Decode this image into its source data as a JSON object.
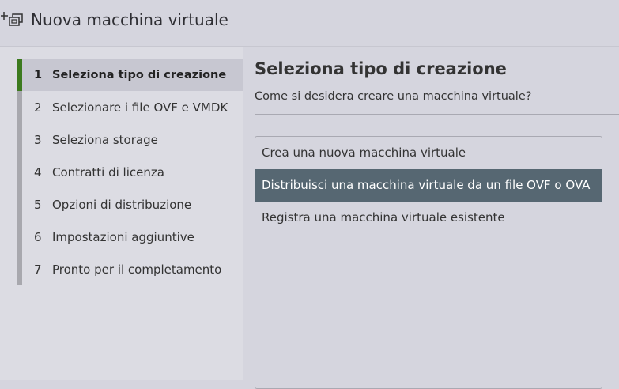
{
  "window": {
    "title": "Nuova macchina virtuale",
    "icon": "new-vm-icon"
  },
  "steps": [
    {
      "num": "1",
      "label": "Seleziona tipo di creazione",
      "active": true
    },
    {
      "num": "2",
      "label": "Selezionare i file OVF e VMDK",
      "active": false
    },
    {
      "num": "3",
      "label": "Seleziona storage",
      "active": false
    },
    {
      "num": "4",
      "label": "Contratti di licenza",
      "active": false
    },
    {
      "num": "5",
      "label": "Opzioni di distribuzione",
      "active": false
    },
    {
      "num": "6",
      "label": "Impostazioni aggiuntive",
      "active": false
    },
    {
      "num": "7",
      "label": "Pronto per il completamento",
      "active": false
    }
  ],
  "main": {
    "heading": "Seleziona tipo di creazione",
    "question": "Come si desidera creare una macchina virtuale?",
    "options": [
      {
        "label": "Crea una nuova macchina virtuale",
        "selected": false
      },
      {
        "label": "Distribuisci una macchina virtuale da un file OVF o OVA",
        "selected": true
      },
      {
        "label": "Registra una macchina virtuale esistente",
        "selected": false
      }
    ]
  },
  "colors": {
    "active_step_accent": "#3c7a1e",
    "selected_option_bg": "#566772"
  }
}
